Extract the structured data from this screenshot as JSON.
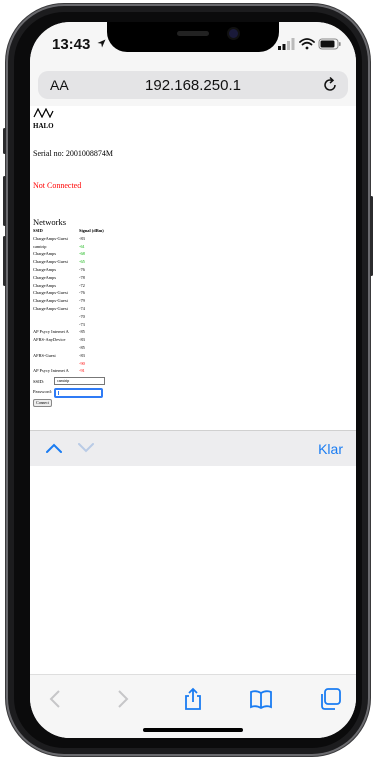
{
  "status_bar": {
    "time": "13:43"
  },
  "address_bar": {
    "text_size_label": "AA",
    "url": "192.168.250.1"
  },
  "page": {
    "brand": "HALO",
    "serial": "Serial no: 2001008874M",
    "connection_status": "Not Connected",
    "networks_heading": "Networks",
    "table_headers": {
      "ssid": "SSID",
      "signal": "Signal (dBm)"
    },
    "networks": [
      {
        "ssid": "ChargeAmps-Guest",
        "signal": "-83",
        "level": "mid"
      },
      {
        "ssid": "camtrip",
        "signal": "-61",
        "level": "good"
      },
      {
        "ssid": "ChargeAmps",
        "signal": "-68",
        "level": "good"
      },
      {
        "ssid": "ChargeAmps-Guest",
        "signal": "-65",
        "level": "good"
      },
      {
        "ssid": "ChargeAmps",
        "signal": "-76",
        "level": "mid"
      },
      {
        "ssid": "ChargeAmps",
        "signal": "-78",
        "level": "mid"
      },
      {
        "ssid": "ChargeAmps",
        "signal": "-72",
        "level": "mid"
      },
      {
        "ssid": "ChargeAmps-Guest",
        "signal": "-76",
        "level": "mid"
      },
      {
        "ssid": "ChargeAmps-Guest",
        "signal": "-79",
        "level": "mid"
      },
      {
        "ssid": "ChargeAmps-Guest",
        "signal": "-74",
        "level": "mid"
      },
      {
        "ssid": "",
        "signal": "-70",
        "level": "mid"
      },
      {
        "ssid": "",
        "signal": "-73",
        "level": "mid"
      },
      {
        "ssid": "AP Psycy Internet A",
        "signal": "-85",
        "level": "mid"
      },
      {
        "ssid": "AFRS-AnyDevice",
        "signal": "-83",
        "level": "mid"
      },
      {
        "ssid": "",
        "signal": "-85",
        "level": "mid"
      },
      {
        "ssid": "AFRS-Guest",
        "signal": "-83",
        "level": "mid"
      },
      {
        "ssid": "",
        "signal": "-90",
        "level": "bad"
      },
      {
        "ssid": "AP Psycy Internet A",
        "signal": "-91",
        "level": "bad"
      }
    ],
    "form": {
      "ssid_label": "SSID:",
      "ssid_value": "camtrip",
      "password_label": "Password:",
      "password_value": "",
      "connect_label": "Connect"
    }
  },
  "accessory_bar": {
    "done_label": "Klar"
  },
  "colors": {
    "accent": "#1a7cf2",
    "error": "#ff0000",
    "signal_good": "#00b000"
  },
  "toolbar": {
    "icons": [
      "back-icon",
      "forward-icon",
      "share-icon",
      "bookmarks-icon",
      "tabs-icon"
    ]
  }
}
